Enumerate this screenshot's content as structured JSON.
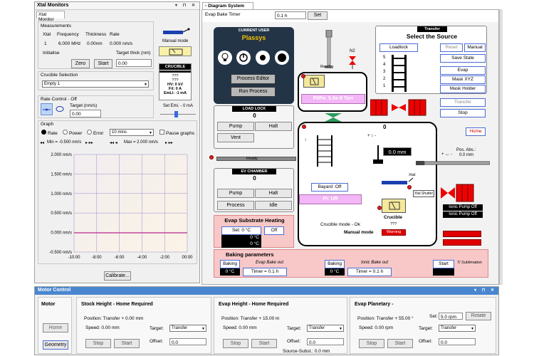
{
  "xtal": {
    "window_title": "Xtal Monitors",
    "tab": "Xtal Monitor",
    "measurements_label": "Measurements",
    "col_xtal": "Xtal",
    "col_freq": "Frequency",
    "col_thick": "Thickness",
    "col_rate": "Rate",
    "row_xtal": "1",
    "row_freq": "6.000 MHz",
    "row_thick": "0.00nm",
    "row_rate": "0.000 nm/s",
    "initialise": "Initialise",
    "target_thick_label": "Target thick (nm)",
    "zero": "Zero",
    "start": "Start",
    "target_thick_value": "0.00",
    "manual_mode": "Manual mode",
    "crucible": "CRUCIBLE",
    "q1": "???",
    "q2": "???",
    "hv": "HV: 0 kV",
    "fil": "Fil: 0 A",
    "emi": "EmLi: -1 mA",
    "set_emi": "Set Emi. - 0 mA",
    "crucible_sel_label": "Crucible Selection",
    "crucible_sel_value": "Empty 1",
    "rate_control_label": "Rate Control - Off",
    "target_rate_label": "Target (nm/s)",
    "target_rate_value": "0.00",
    "graph_label": "Graph",
    "radio_rate": "Rate",
    "radio_power": "Power",
    "radio_error": "Error",
    "time_range": "10 mins",
    "pause": "Pause graphs",
    "min_label": "Min = -0.500 nm/s",
    "max_label": "Max = 2.000 nm/s",
    "y_ticks": [
      "2.000 nm/s",
      "1.500 nm/s",
      "1.000 nm/s",
      "0.500 nm/s",
      "0.000 nm/s",
      "-0.500 nm/s"
    ],
    "x_ticks": [
      "-10:00",
      "-8:00",
      "-6:00",
      "-4:00",
      "-2:00",
      "00:00"
    ],
    "calibrate": "Calibrate..."
  },
  "diagram": {
    "tab": "Diagram System",
    "timer_label": "Evap Bake Timer",
    "timer_value": "0.1 h",
    "set": "Set",
    "current_user_label": "CURRENT USER",
    "current_user": "Plassys",
    "process_editor": "Process Editor",
    "run_process": "Run Process",
    "n2": "N2",
    "ready1": "Ready",
    "pressure": "PI/Pe: 5.0e-9 Torr",
    "transfer": "Transfer",
    "select_source": "Select the Source",
    "loadlock": "Loadlock",
    "reset": "Reset",
    "manual": "Manual",
    "save_state": "Save State",
    "evap": "Evap",
    "mask_xyz": "Mask XYZ",
    "mask_holder": "Mask Holder",
    "transfer_btn": "Transfer",
    "stop": "Stop",
    "home": "Home",
    "slots": [
      "5",
      "4",
      "3",
      "2",
      "1"
    ],
    "loadlock_label": "LOAD LOCK",
    "loadlock_val": "0",
    "pump": "Pump",
    "halt": "Halt",
    "vent": "Vent",
    "ready2": "Ready",
    "ev_chamber": "EV CHAMBER",
    "ev_val": "0",
    "pump2": "Pump",
    "halt2": "Halt",
    "process": "Process",
    "idle": "Idle",
    "center_val": "0",
    "mm_val": "0.0 mm",
    "pos_abs_label": "Pos. Abs.:",
    "pos_abs_val": "0.0 mm",
    "bayard": "Bayard :Off",
    "pi_ur": "Pi: UR",
    "xtal": "Xtal",
    "xtal_shutter": "Xtal Shutter",
    "crucible": "Crucible",
    "crucible_mode": "Crucible mode - Ok",
    "q3": "???",
    "manual_mode": "Manual mode",
    "warning": "Warning",
    "ionic_off": "Ionic Pump Off",
    "ionic_off2": "Ionic Pump Off",
    "sub_heat_title": "Evap Substrate Heating",
    "sub_set": "Set: 0 °C",
    "sub_off": "Off",
    "sub_t1": "0 °C",
    "sub_t2": "0 °C",
    "baking_title": "Baking parameters",
    "baking1": "Baking",
    "bake_out1": "Evap Bake out",
    "temp1": "0 °C",
    "timer1": "Timer = 0.1 h",
    "baking2": "Baking",
    "bake_out2": "Ionic Bake out",
    "temp2": "0 °C",
    "timer2": "Timer = 0.1 h",
    "start": "Start",
    "ti_sub": "Ti Sublimation"
  },
  "motor": {
    "title": "Motor Control",
    "motor_label": "Motor",
    "home": "Home",
    "geometry": "Geometry",
    "sections": [
      {
        "title": "Stock Height - Home Required",
        "position": "Position: Transfer + 0.00 mm",
        "speed": "Speed:  0.00 mm",
        "target_label": "Target:",
        "target": "Transfer",
        "offset_label": "Offset:",
        "offset": "0.0",
        "stop": "Stop",
        "start": "Start"
      },
      {
        "title": "Evap Height - Home Required",
        "position": "Position: Transfer + 15.00 m",
        "speed": "Speed:  0.00 mm",
        "target_label": "Target:",
        "target": "Transfer",
        "offset_label": "Offset:",
        "offset": "0.0",
        "stop": "Stop",
        "start": "Start",
        "extra": "Source-Subst.: 0.0 mm"
      },
      {
        "title": "Evap Planetary -",
        "position": "Position: Transfer + 55.00 °",
        "speed": "Speed:  0.00 rpm",
        "target_label": "Target:",
        "target": "Transfer",
        "offset_label": "Offset:",
        "offset": "0.0",
        "stop": "Stop",
        "start": "Start",
        "set_label": "Set:",
        "set_val": "5.0 rpm",
        "rotate": "Rotate"
      }
    ]
  },
  "colors": {
    "accent": "#4a6cd4",
    "pink": "#f3b6f6",
    "red": "#e00000",
    "graph_line": "#c03090"
  }
}
